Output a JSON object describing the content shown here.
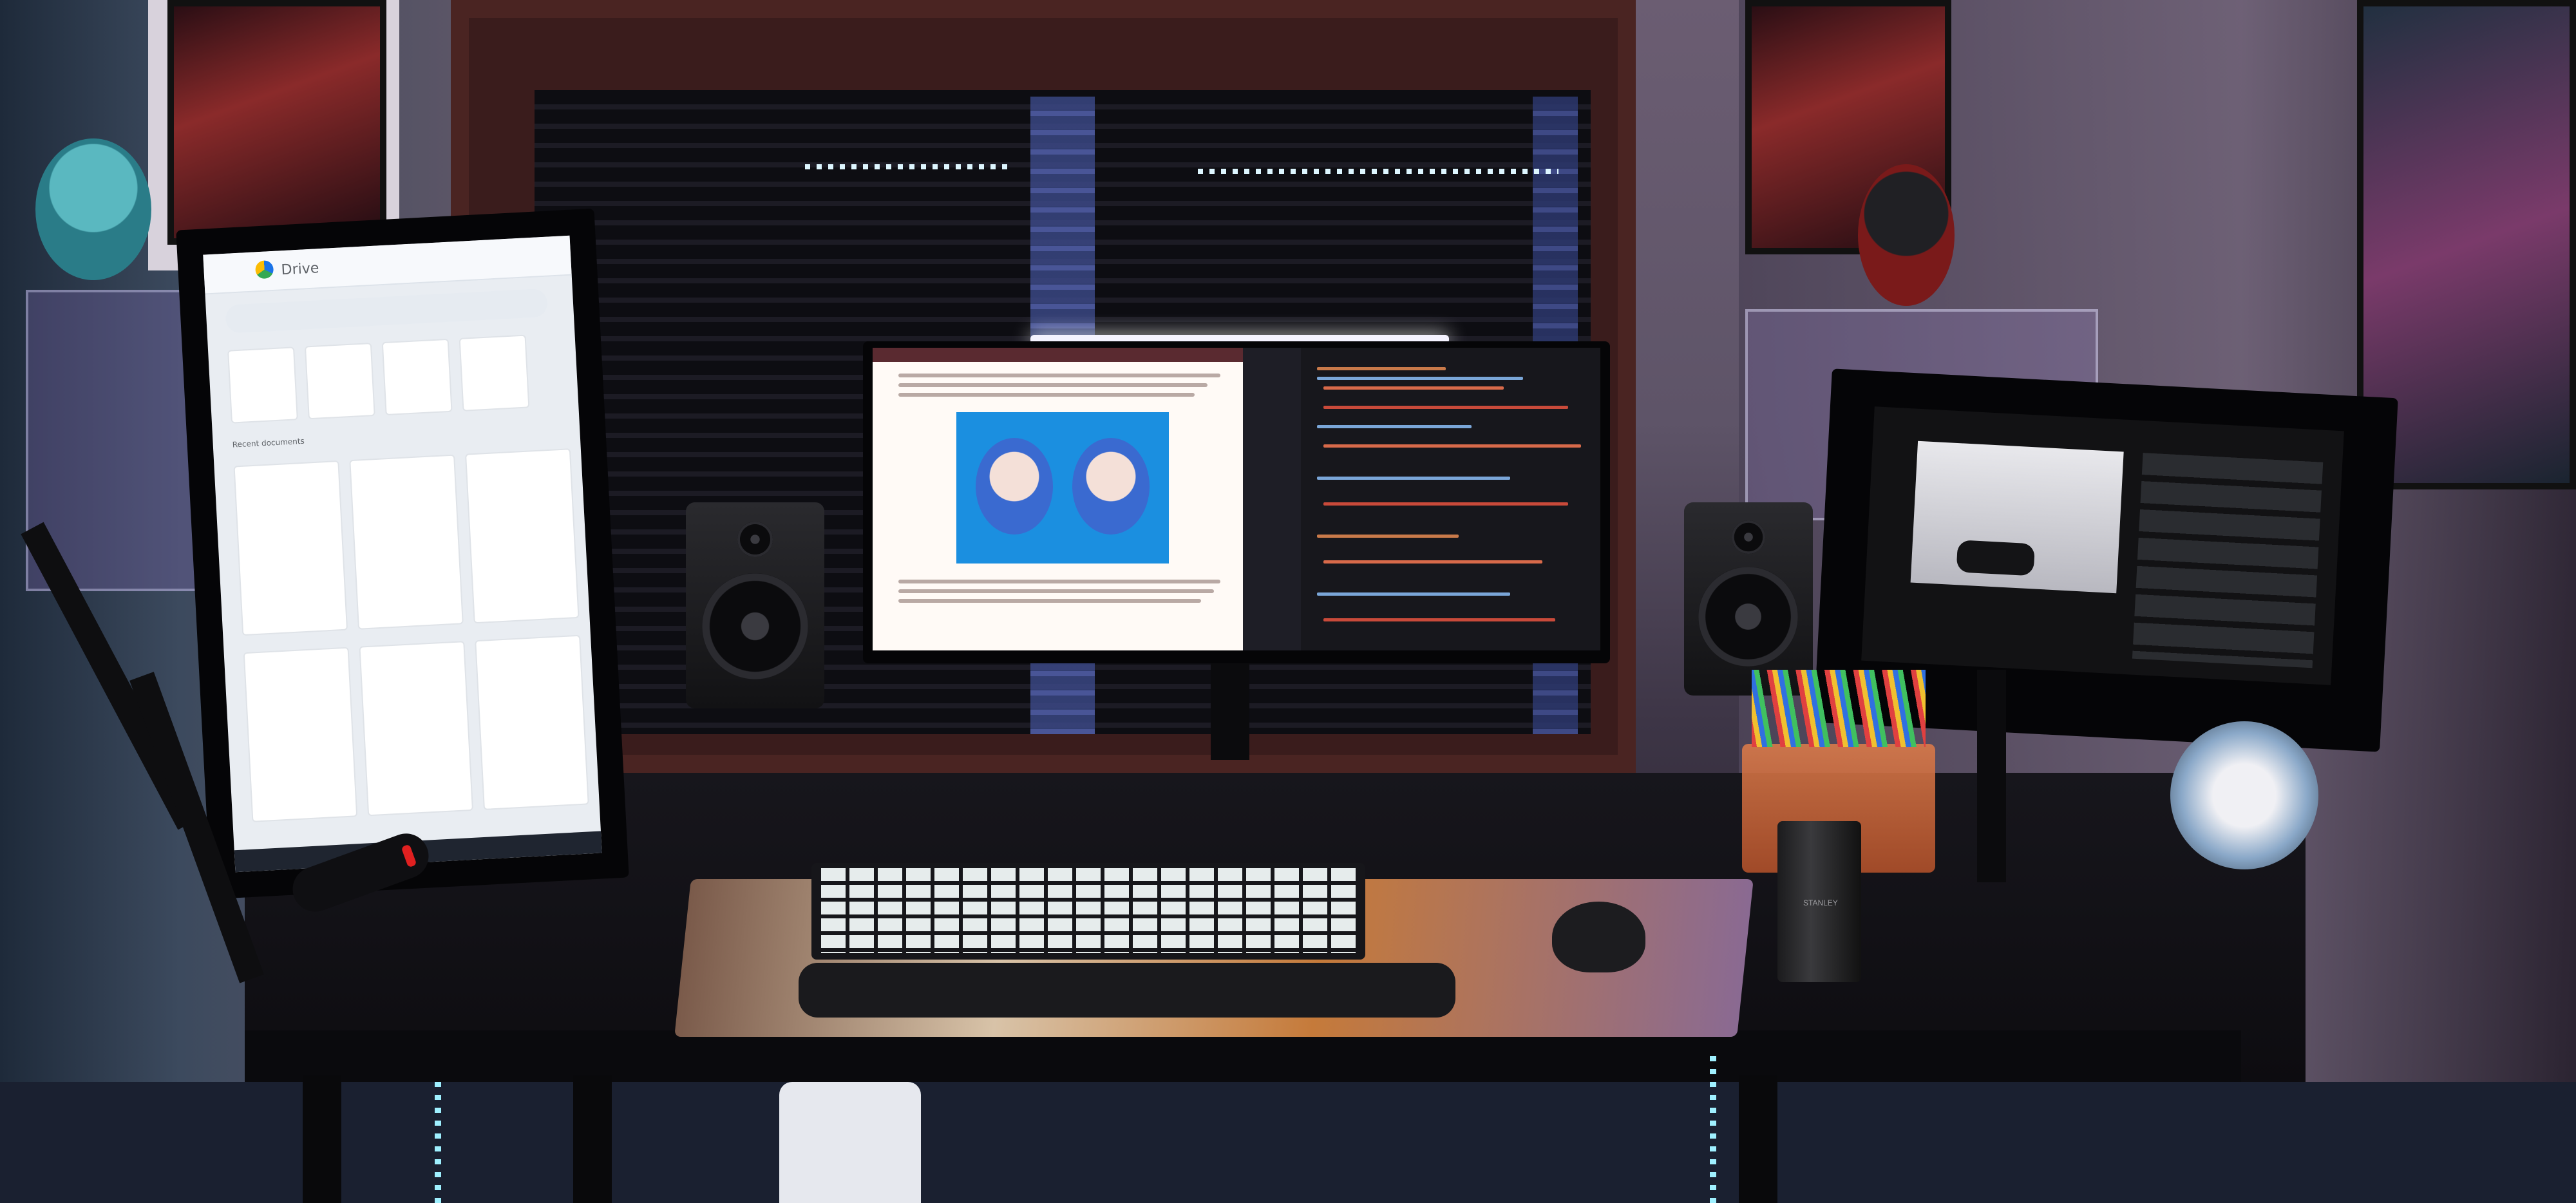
{
  "scene": {
    "description_tag": "photo",
    "accent_colors": {
      "led": "#ddf6ff",
      "wall_purple": "#6b5d72",
      "drive_blue": "#1a73e8",
      "fumo_bg": "#1b8fe0"
    }
  },
  "left_monitor": {
    "app_title": "Drive",
    "section_label": "Recent documents"
  },
  "center_monitor": {
    "left_pane": "browser-article",
    "right_pane": "code-editor"
  },
  "right_monitor": {
    "content": "video-player"
  },
  "thermos": {
    "label": "STANLEY"
  },
  "icons": [
    "drive-logo-icon",
    "fumo-figure-icon",
    "speaker-icon",
    "keyboard-icon",
    "mouse-icon"
  ]
}
